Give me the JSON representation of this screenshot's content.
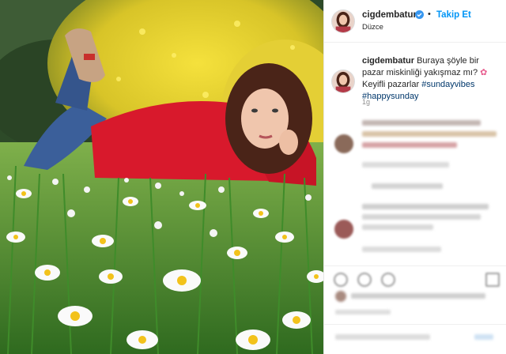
{
  "post": {
    "username": "cigdembatur",
    "follow_label": "Takip Et",
    "dot": "•",
    "location": "Düzce"
  },
  "caption": {
    "username": "cigdembatur",
    "text_part1": "Buraya şöyle bir pazar miskinliği yakışmaz mı?",
    "flower_emoji": "✿",
    "text_part2": "Keyifli pazarlar",
    "hashtag1": "#sundayvibes",
    "hashtag2": "#happysunday",
    "time_ago": "1g"
  },
  "colors": {
    "follow_blue": "#0095f6",
    "hashtag_blue": "#00376b",
    "verified_blue": "#3897f0",
    "sweater_red": "#d8192c"
  },
  "icons": {
    "verified": "verified-badge-icon",
    "like": "heart-icon",
    "comment": "comment-icon",
    "share": "share-icon",
    "save": "bookmark-icon"
  }
}
